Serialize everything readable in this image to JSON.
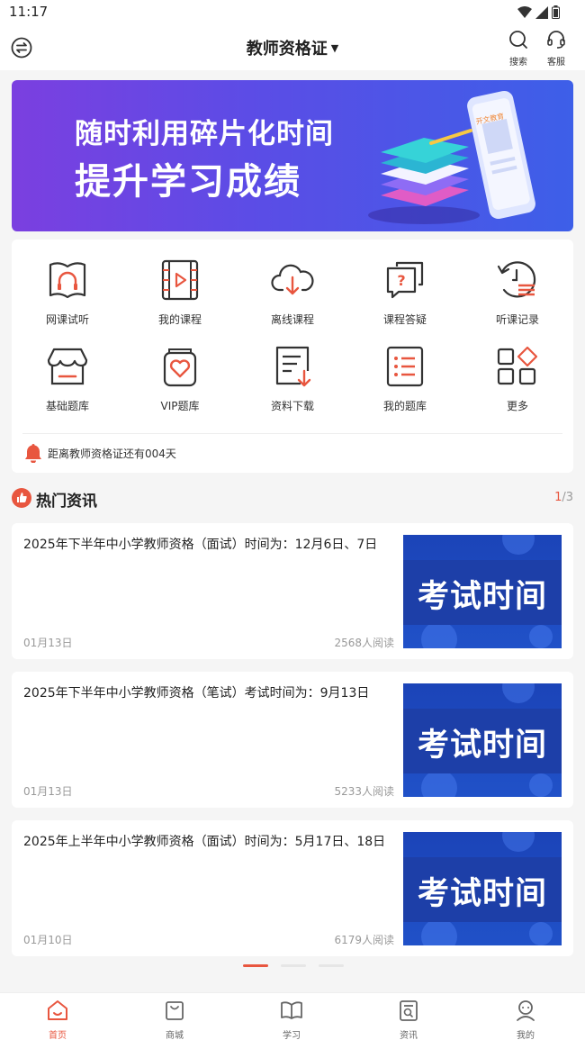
{
  "status_bar": {
    "time": "11:17"
  },
  "header": {
    "title": "教师资格证",
    "search_label": "搜索",
    "service_label": "客服"
  },
  "banner": {
    "line1": "随时利用碎片化时间",
    "line2": "提升学习成绩",
    "phone_text": "开文教育"
  },
  "shortcuts": [
    {
      "label": "网课试听",
      "icon": "book-headphones-icon"
    },
    {
      "label": "我的课程",
      "icon": "video-course-icon"
    },
    {
      "label": "离线课程",
      "icon": "cloud-download-icon"
    },
    {
      "label": "课程答疑",
      "icon": "question-chat-icon"
    },
    {
      "label": "听课记录",
      "icon": "history-icon"
    },
    {
      "label": "基础题库",
      "icon": "store-icon"
    },
    {
      "label": "VIP题库",
      "icon": "vip-heart-icon"
    },
    {
      "label": "资料下载",
      "icon": "document-download-icon"
    },
    {
      "label": "我的题库",
      "icon": "list-icon"
    },
    {
      "label": "更多",
      "icon": "more-grid-icon"
    }
  ],
  "countdown": {
    "text": "距离教师资格证还有004天"
  },
  "hot_news": {
    "title": "热门资讯",
    "page_current": "1",
    "page_total": "/3",
    "items": [
      {
        "title": "2025年下半年中小学教师资格（面试）时间为：12月6日、7日",
        "date": "01月13日",
        "reads": "2568人阅读",
        "thumb_text": "考试时间"
      },
      {
        "title": "2025年下半年中小学教师资格（笔试）考试时间为：9月13日",
        "date": "01月13日",
        "reads": "5233人阅读",
        "thumb_text": "考试时间"
      },
      {
        "title": "2025年上半年中小学教师资格（面试）时间为：5月17日、18日",
        "date": "01月10日",
        "reads": "6179人阅读",
        "thumb_text": "考试时间"
      }
    ]
  },
  "pagination": {
    "active_index": 0,
    "count": 3
  },
  "tabs": [
    {
      "label": "首页",
      "active": true
    },
    {
      "label": "商城",
      "active": false
    },
    {
      "label": "学习",
      "active": false
    },
    {
      "label": "资讯",
      "active": false
    },
    {
      "label": "我的",
      "active": false
    }
  ],
  "colors": {
    "accent": "#e8563f",
    "banner_start": "#7b3fe0",
    "banner_end": "#3d5fe8",
    "thumb_blue": "#1d3fa8"
  }
}
